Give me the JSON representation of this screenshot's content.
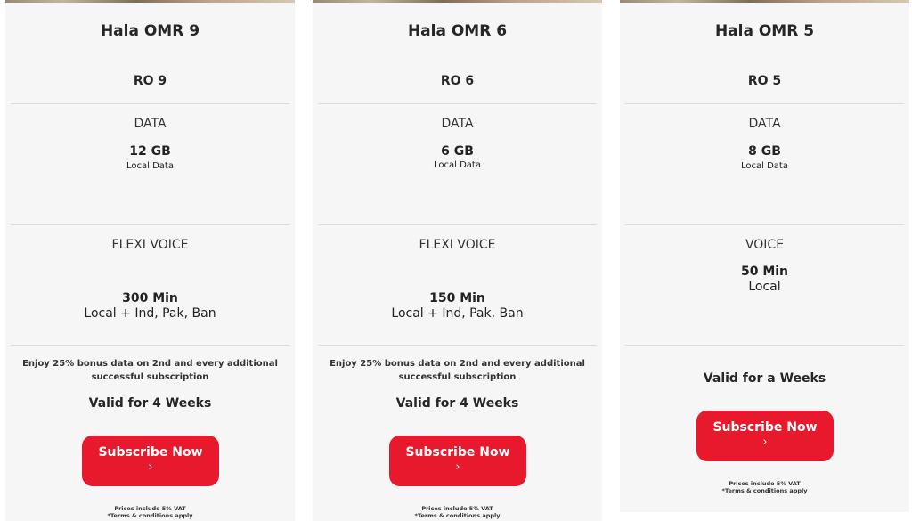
{
  "plans": [
    {
      "title": "Hala OMR 9",
      "price": "RO 9",
      "data_heading": "DATA",
      "data_amount": "12 GB",
      "data_scope": "Local Data",
      "voice_heading": "FLEXI VOICE",
      "voice_amount": "300 Min",
      "voice_scope": "Local + Ind, Pak, Ban",
      "bonus": "Enjoy 25% bonus data on 2nd and every additional successful subscription",
      "validity": "Valid for 4 Weeks",
      "cta_label": "Subscribe Now",
      "cta_icon": "chevron-right-icon",
      "cta_chevron": "›",
      "vat_note": "Prices include 5% VAT",
      "terms_note": "*Terms & conditions apply"
    },
    {
      "title": "Hala OMR 6",
      "price": "RO 6",
      "data_heading": "DATA",
      "data_amount": "6 GB",
      "data_scope": "Local Data",
      "voice_heading": "FLEXI VOICE",
      "voice_amount": "150 Min",
      "voice_scope": "Local + Ind, Pak, Ban",
      "bonus": "Enjoy 25% bonus data on 2nd and every additional successful subscription",
      "validity": "Valid for 4 Weeks",
      "cta_label": "Subscribe Now",
      "cta_icon": "chevron-right-icon",
      "cta_chevron": "›",
      "vat_note": "Prices include 5% VAT",
      "terms_note": "*Terms & conditions apply"
    },
    {
      "title": "Hala OMR 5",
      "price": "RO 5",
      "data_heading": "DATA",
      "data_amount": "8 GB",
      "data_scope": "Local Data",
      "voice_heading": "VOICE",
      "voice_amount": "50 Min",
      "voice_scope": "Local",
      "validity": "Valid for a Weeks",
      "cta_label": "Subscribe Now",
      "cta_icon": "chevron-right-icon",
      "cta_chevron": "›",
      "vat_note": "Prices include 5% VAT",
      "terms_note": "*Terms & conditions apply"
    }
  ],
  "colors": {
    "card_background": "#f6f6f6",
    "cta_red": "#e8192c",
    "divider": "#dcdcdc",
    "text": "#222222"
  }
}
